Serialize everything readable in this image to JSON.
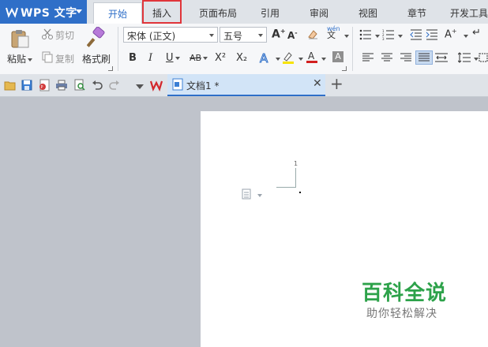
{
  "app": {
    "title": "WPS 文字"
  },
  "tabs": [
    {
      "label": "开始"
    },
    {
      "label": "插入"
    },
    {
      "label": "页面布局"
    },
    {
      "label": "引用"
    },
    {
      "label": "审阅"
    },
    {
      "label": "视图"
    },
    {
      "label": "章节"
    },
    {
      "label": "开发工具"
    }
  ],
  "active_tab": "开始",
  "highlighted_tab": "插入",
  "ribbon": {
    "paste_label": "粘贴",
    "cut_label": "剪切",
    "copy_label": "复制",
    "format_painter_label": "格式刷",
    "font_name": "宋体 (正文)",
    "font_size": "五号",
    "bold": "B",
    "italic": "I",
    "underline": "U",
    "strikethrough": "AB",
    "superscript": "X²",
    "subscript": "X₂"
  },
  "quick_access": {
    "document_tab": "文档1 *"
  },
  "document": {
    "page_number": "1"
  },
  "watermark": {
    "title": "百科全说",
    "subtitle": "助你轻松解决"
  },
  "colors": {
    "accent": "#2f6fc8",
    "highlight_outline": "#e0353a",
    "watermark_green": "#2da24a",
    "font_color_bar": "#d21f1f",
    "highlight_bar": "#f7e300"
  }
}
